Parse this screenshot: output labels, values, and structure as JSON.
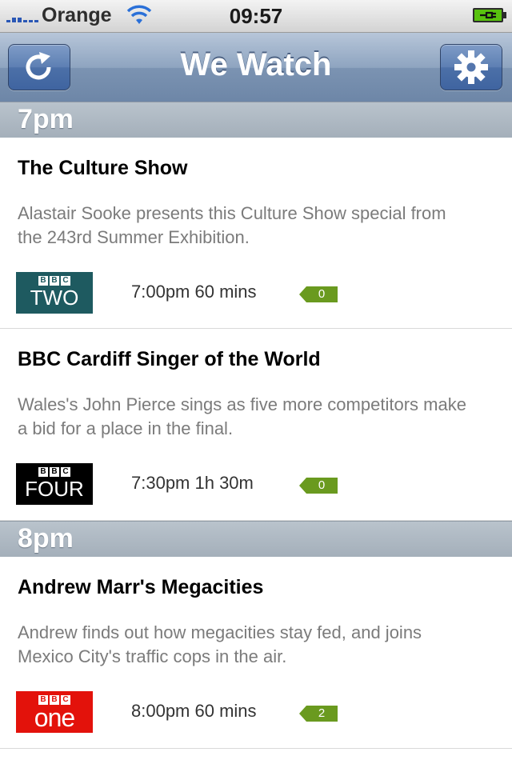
{
  "status_bar": {
    "carrier": "Orange",
    "time": "09:57"
  },
  "nav": {
    "title": "We Watch"
  },
  "sections": [
    {
      "label": "7pm",
      "programmes": [
        {
          "title": "The Culture Show",
          "description": "Alastair Sooke presents this Culture Show special from the 243rd Summer Exhibition.",
          "channel_logo": {
            "bbc": [
              "B",
              "B",
              "C"
            ],
            "name": "TWO"
          },
          "time": "7:00pm 60 mins",
          "count": "0"
        },
        {
          "title": "BBC Cardiff Singer of the World",
          "description": "Wales's John Pierce sings as five more competitors make a bid for a place in the final.",
          "channel_logo": {
            "bbc": [
              "B",
              "B",
              "C"
            ],
            "name": "FOUR"
          },
          "time": "7:30pm 1h 30m",
          "count": "0"
        }
      ]
    },
    {
      "label": "8pm",
      "programmes": [
        {
          "title": "Andrew Marr's Megacities",
          "description": "Andrew finds out how megacities stay fed, and joins Mexico City's traffic cops in the air.",
          "channel_logo": {
            "bbc": [
              "B",
              "B",
              "C"
            ],
            "name": "one"
          },
          "time": "8:00pm 60 mins",
          "count": "2"
        }
      ]
    }
  ],
  "colors": {
    "nav_bar": "#7b93b2",
    "section_header": "#a4afba",
    "count_tag": "#6a9a1f",
    "bbc_two": "#1e5a60",
    "bbc_four": "#000000",
    "bbc_one": "#e3120b"
  },
  "icons": {
    "refresh": "refresh-icon",
    "settings": "gear-icon"
  }
}
